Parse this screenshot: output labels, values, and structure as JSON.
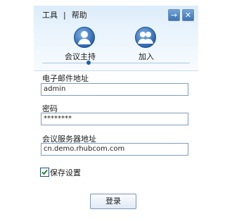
{
  "menu": {
    "tools": "工具",
    "separator": "|",
    "help": "帮助"
  },
  "window": {
    "arrow_glyph": "→",
    "close_glyph": "✕"
  },
  "tabs": [
    {
      "label": "会议主持",
      "icon": "single-user-icon",
      "selected": true
    },
    {
      "label": "加入",
      "icon": "group-users-icon",
      "selected": false
    }
  ],
  "form": {
    "email_label": "电子邮件地址",
    "email_value": "admin",
    "password_label": "密码",
    "password_value": "********",
    "server_label": "会议服务器地址",
    "server_value": "cn.demo.rhubcom.com",
    "save_label": "保存设置",
    "save_checked": true,
    "login_label": "登录"
  },
  "colors": {
    "accent": "#1f5ea8",
    "header_bg": "#dcecfa"
  }
}
